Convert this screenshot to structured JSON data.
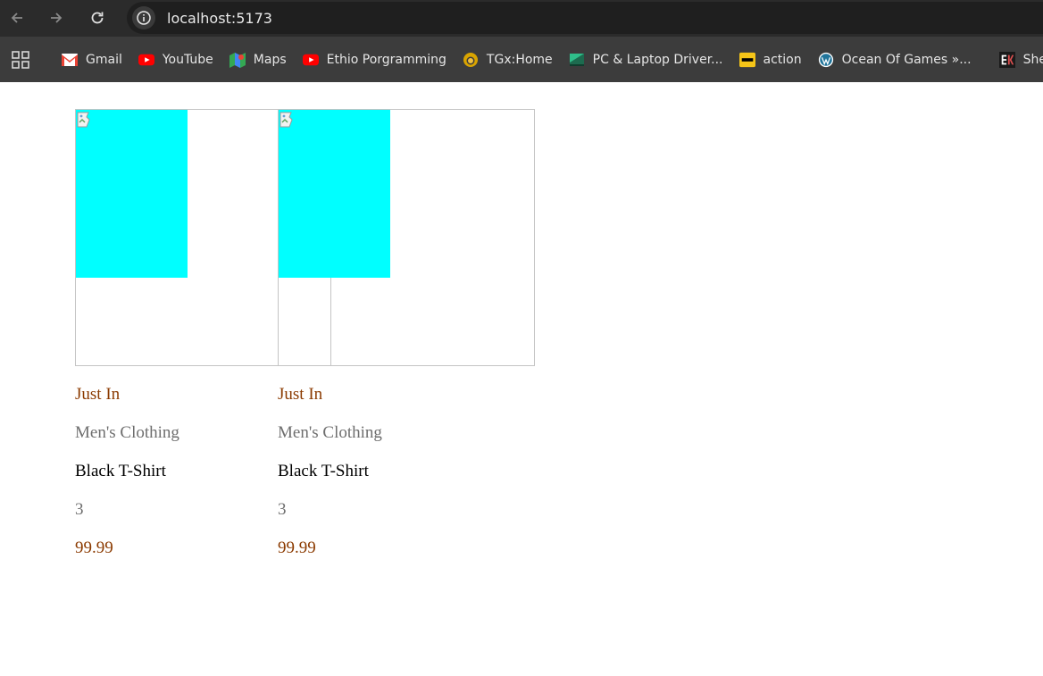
{
  "browser": {
    "url": "localhost:5173",
    "bookmarks": [
      {
        "label": "Gmail",
        "icon": "gmail-icon"
      },
      {
        "label": "YouTube",
        "icon": "youtube-icon"
      },
      {
        "label": "Maps",
        "icon": "maps-icon"
      },
      {
        "label": "Ethio Porgramming",
        "icon": "youtube-icon"
      },
      {
        "label": "TGx:Home",
        "icon": "tgx-icon"
      },
      {
        "label": "PC & Laptop Driver...",
        "icon": "driver-icon"
      },
      {
        "label": "action",
        "icon": "imdb-icon"
      },
      {
        "label": "Ocean Of Games »...",
        "icon": "wordpress-icon"
      },
      {
        "label": "Sheg",
        "icon": "sheg-icon"
      }
    ]
  },
  "products": [
    {
      "tag": "Just In",
      "category": "Men's Clothing",
      "name": "Black T-Shirt",
      "quantity": "3",
      "price": "99.99"
    },
    {
      "tag": "Just In",
      "category": "Men's Clothing",
      "name": "Black T-Shirt",
      "quantity": "3",
      "price": "99.99"
    }
  ],
  "colors": {
    "image_placeholder": "#00ffff",
    "accent": "#8b3a00",
    "muted": "#6e6e6e",
    "chrome_dark": "#2b2b2b",
    "chrome": "#3c3c3c"
  }
}
